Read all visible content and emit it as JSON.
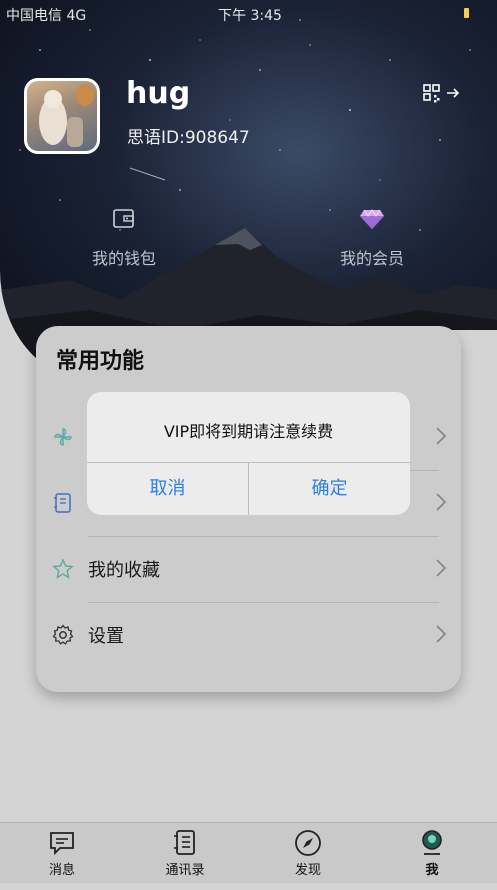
{
  "status_bar": {
    "carrier": "中国电信 4G",
    "time": "下午 3:45"
  },
  "profile": {
    "nickname": "hug",
    "id_label": "思语ID:908647"
  },
  "quick_actions": [
    {
      "label": "我的钱包",
      "icon": "wallet-icon"
    },
    {
      "label": "我的会员",
      "icon": "diamond-icon"
    }
  ],
  "common_functions": {
    "title": "常用功能",
    "items": [
      {
        "label": "",
        "icon": "pinwheel-icon"
      },
      {
        "label": "",
        "icon": "notebook-icon"
      },
      {
        "label": "我的收藏",
        "icon": "star-icon"
      },
      {
        "label": "设置",
        "icon": "gear-icon"
      }
    ]
  },
  "alert": {
    "message": "VIP即将到期请注意续费",
    "cancel": "取消",
    "confirm": "确定"
  },
  "tabbar": [
    {
      "label": "消息",
      "icon": "message-icon"
    },
    {
      "label": "通讯录",
      "icon": "contacts-icon"
    },
    {
      "label": "发现",
      "icon": "compass-icon"
    },
    {
      "label": "我",
      "icon": "profile-icon"
    }
  ],
  "colors": {
    "accent": "#2a7ee6",
    "battery": "#f4d34a",
    "card": "#cccccc"
  }
}
